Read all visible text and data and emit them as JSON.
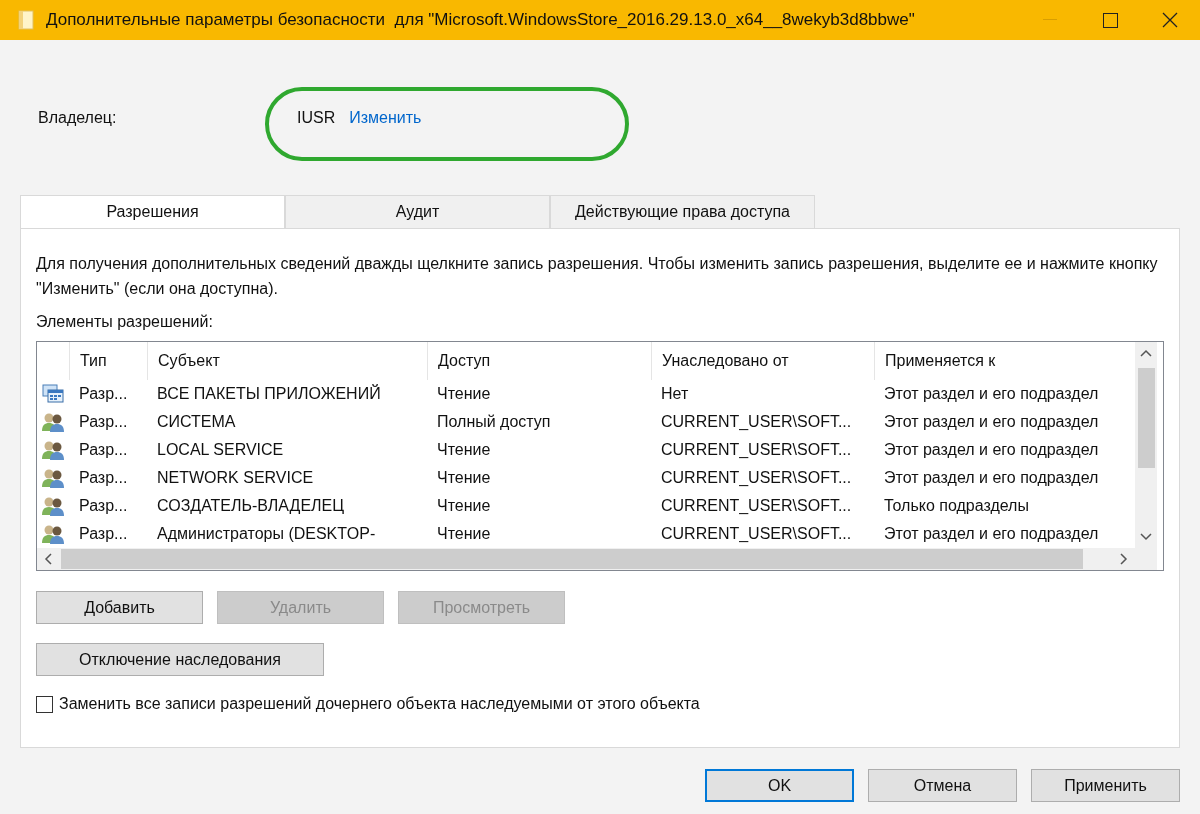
{
  "window": {
    "title": "Дополнительные параметры безопасности  для \"Microsoft.WindowsStore_2016.29.13.0_x64__8wekyb3d8bbwe\""
  },
  "owner": {
    "label": "Владелец:",
    "value": "IUSR",
    "link": "Изменить",
    "highlighted": true
  },
  "tabs": [
    {
      "label": "Разрешения",
      "selected": true
    },
    {
      "label": "Аудит",
      "selected": false
    },
    {
      "label": "Действующие права доступа",
      "selected": false
    }
  ],
  "description": "Для получения дополнительных сведений дважды щелкните запись разрешения. Чтобы изменить запись разрешения, выделите ее и нажмите кнопку \"Изменить\" (если она доступна).",
  "permissions": {
    "label": "Элементы разрешений:",
    "columns": [
      "Тип",
      "Субъект",
      "Доступ",
      "Унаследовано от",
      "Применяется к"
    ],
    "rows": [
      {
        "kind": "package",
        "type": "Разр...",
        "subject": "ВСЕ ПАКЕТЫ ПРИЛОЖЕНИЙ",
        "access": "Чтение",
        "inherited_from": "Нет",
        "applies_to": "Этот раздел и его подраздел"
      },
      {
        "kind": "users",
        "type": "Разр...",
        "subject": "СИСТЕМА",
        "access": "Полный доступ",
        "inherited_from": "CURRENT_USER\\SOFT...",
        "applies_to": "Этот раздел и его подраздел"
      },
      {
        "kind": "users",
        "type": "Разр...",
        "subject": "LOCAL SERVICE",
        "access": "Чтение",
        "inherited_from": "CURRENT_USER\\SOFT...",
        "applies_to": "Этот раздел и его подраздел"
      },
      {
        "kind": "users",
        "type": "Разр...",
        "subject": "NETWORK SERVICE",
        "access": "Чтение",
        "inherited_from": "CURRENT_USER\\SOFT...",
        "applies_to": "Этот раздел и его подраздел"
      },
      {
        "kind": "users",
        "type": "Разр...",
        "subject": "СОЗДАТЕЛЬ-ВЛАДЕЛЕЦ",
        "access": "Чтение",
        "inherited_from": "CURRENT_USER\\SOFT...",
        "applies_to": "Только подразделы"
      },
      {
        "kind": "users",
        "type": "Разр...",
        "subject": "Администраторы (DESKTOP-",
        "access": "Чтение",
        "inherited_from": "CURRENT_USER\\SOFT...",
        "applies_to": "Этот раздел и его подраздел"
      }
    ]
  },
  "actions": [
    {
      "label": "Добавить",
      "disabled": false
    },
    {
      "label": "Удалить",
      "disabled": true
    },
    {
      "label": "Просмотреть",
      "disabled": true
    }
  ],
  "inheritance_button": {
    "label": "Отключение наследования",
    "disabled": false
  },
  "replace_checkbox": {
    "label": "Заменить все записи разрешений дочернего объекта наследуемыми от этого объекта",
    "checked": false
  },
  "footer_buttons": [
    {
      "label": "OK",
      "default": true
    },
    {
      "label": "Отмена",
      "default": false
    },
    {
      "label": "Применить",
      "default": false
    }
  ]
}
